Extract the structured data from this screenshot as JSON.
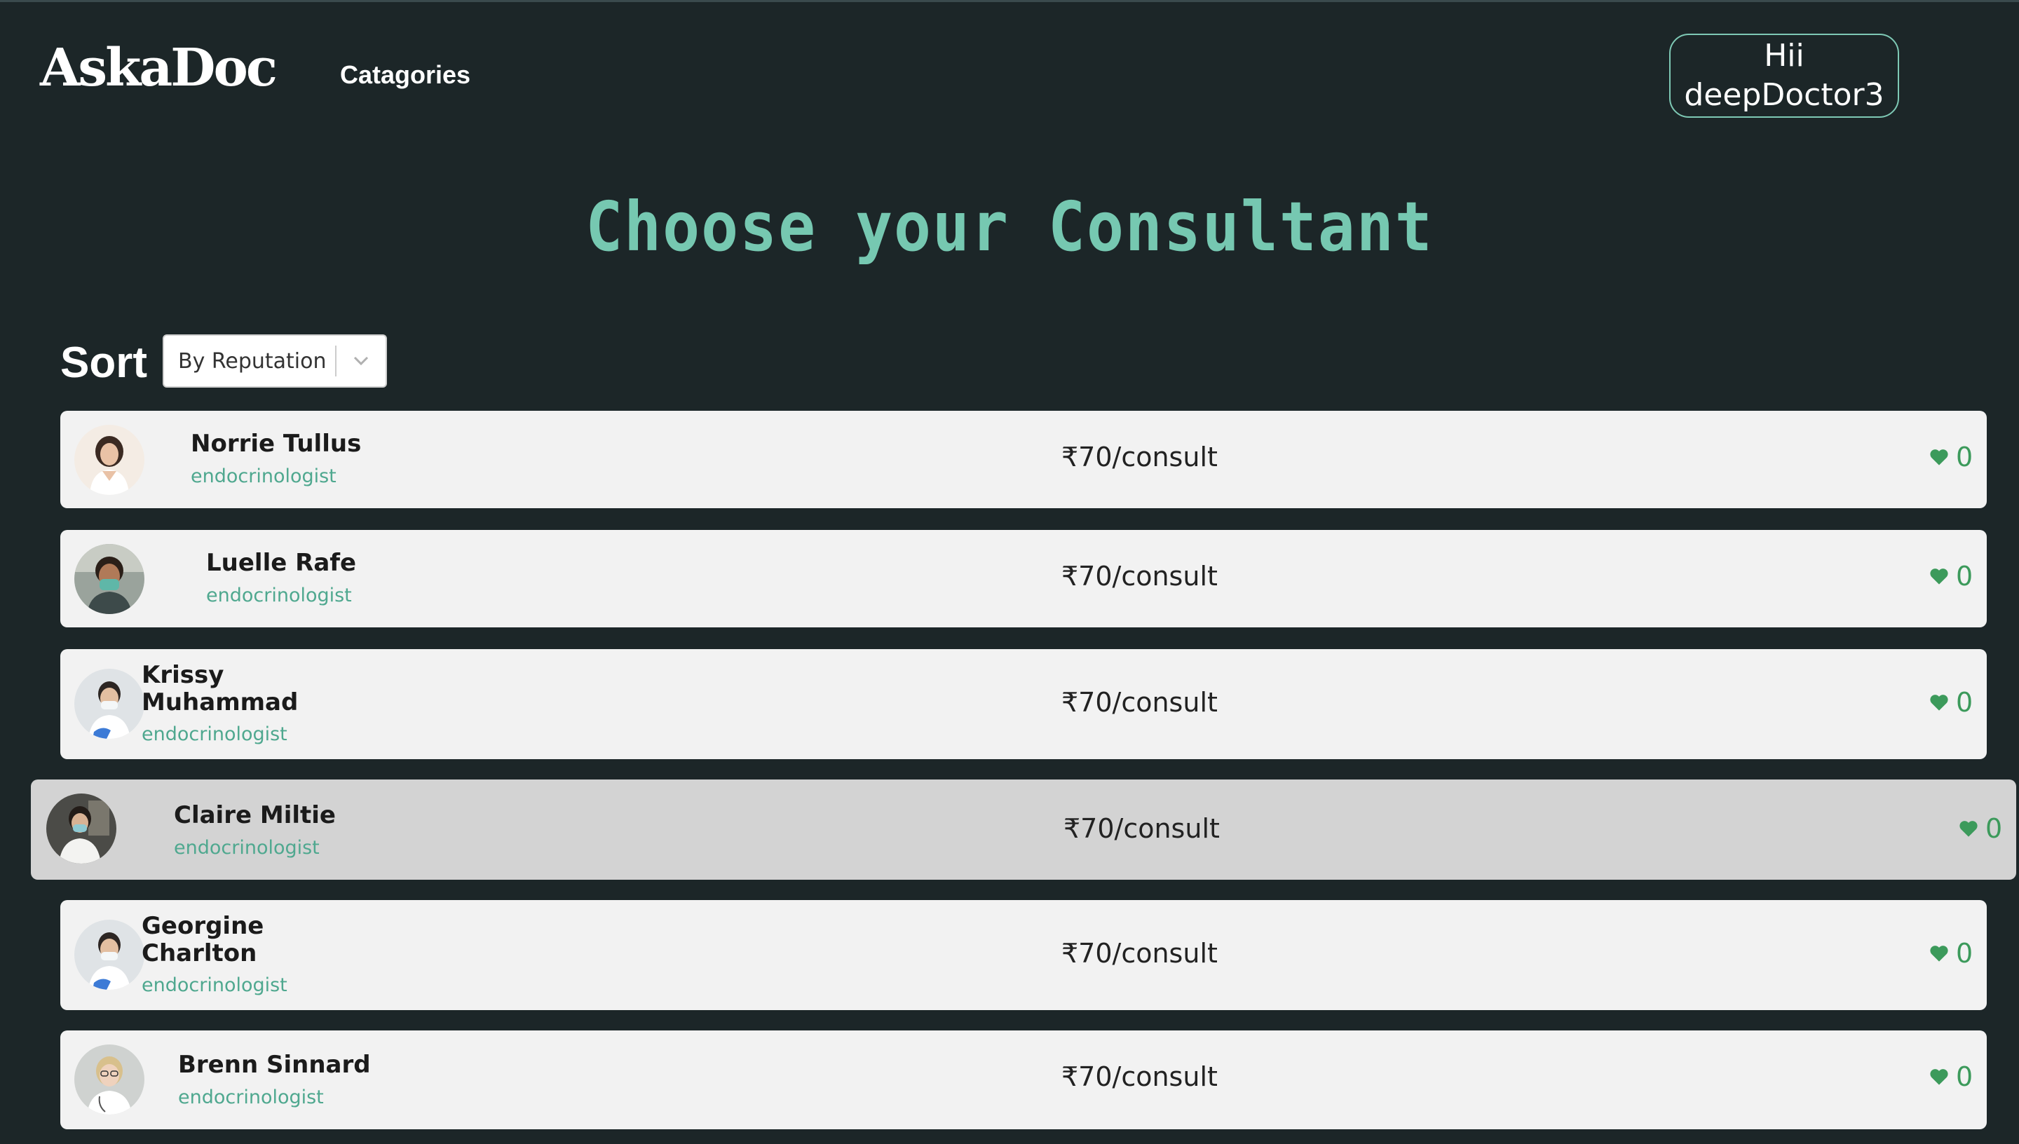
{
  "header": {
    "logo": "AskaDoc",
    "nav_categories": "Catagories",
    "greeting": "Hii",
    "username": "deepDoctor3"
  },
  "main": {
    "title": "Choose your Consultant",
    "sort_label": "Sort",
    "sort_value": "By Reputation"
  },
  "doctors": [
    {
      "name": "Norrie Tullus",
      "specialty": "endocrinologist",
      "price": "₹70/consult",
      "likes": "0"
    },
    {
      "name": "Luelle Rafe",
      "specialty": "endocrinologist",
      "price": "₹70/consult",
      "likes": "0"
    },
    {
      "name": "Krissy Muhammad",
      "specialty": "endocrinologist",
      "price": "₹70/consult",
      "likes": "0"
    },
    {
      "name": "Claire Miltie",
      "specialty": "endocrinologist",
      "price": "₹70/consult",
      "likes": "0"
    },
    {
      "name": "Georgine Charlton",
      "specialty": "endocrinologist",
      "price": "₹70/consult",
      "likes": "0"
    },
    {
      "name": "Brenn Sinnard",
      "specialty": "endocrinologist",
      "price": "₹70/consult",
      "likes": "0"
    }
  ],
  "colors": {
    "background": "#1c2628",
    "accent": "#76c8b1",
    "specialty": "#4fa88f",
    "heart": "#3c9a5b",
    "card": "#f2f2f2",
    "card_hover": "#d3d3d3"
  }
}
